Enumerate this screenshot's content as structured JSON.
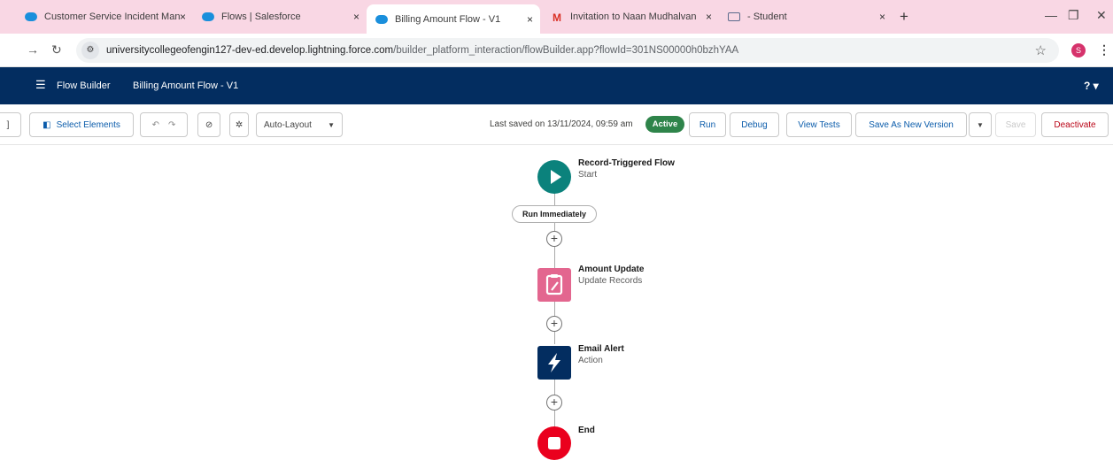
{
  "browser": {
    "tabs": [
      {
        "title": "Customer Service Incident Man",
        "icon": "salesforce-cloud-icon",
        "active": false
      },
      {
        "title": "Flows | Salesforce",
        "icon": "salesforce-cloud-icon",
        "active": false
      },
      {
        "title": "Billing Amount Flow - V1",
        "icon": "salesforce-cloud-icon",
        "active": true
      },
      {
        "title": "Invitation to Naan Mudhalvan",
        "icon": "gmail-icon",
        "active": false
      },
      {
        "title": "- Student",
        "icon": "document-icon",
        "active": false
      }
    ],
    "tab_close_glyph": "×",
    "new_tab_glyph": "+",
    "url_host": "universitycollegeofengin127-dev-ed.develop.lightning.force.com",
    "url_path": "/builder_platform_interaction/flowBuilder.app?flowId=301NS00000h0bzhYAA",
    "profile_initial": "S"
  },
  "header": {
    "app_name": "Flow Builder",
    "flow_name": "Billing Amount Flow - V1",
    "help_label": "? ▾"
  },
  "toolbar": {
    "select_elements": "Select Elements",
    "auto_layout": "Auto-Layout",
    "last_saved": "Last saved on 13/11/2024, 09:59 am",
    "status": "Active",
    "run": "Run",
    "debug": "Debug",
    "view_tests": "View Tests",
    "save_as_new_version": "Save As New Version",
    "save": "Save",
    "deactivate": "Deactivate"
  },
  "flow": {
    "start": {
      "name": "Record-Triggered Flow",
      "type": "Start"
    },
    "run_label": "Run Immediately",
    "nodes": [
      {
        "name": "Amount Update",
        "type": "Update Records",
        "color": "#e3668f",
        "icon": "update-records-icon"
      },
      {
        "name": "Email Alert",
        "type": "Action",
        "color": "#032d60",
        "icon": "lightning-bolt-icon"
      }
    ],
    "end": {
      "name": "End"
    },
    "colors": {
      "start": "#0b827c",
      "end": "#ea001e"
    }
  }
}
